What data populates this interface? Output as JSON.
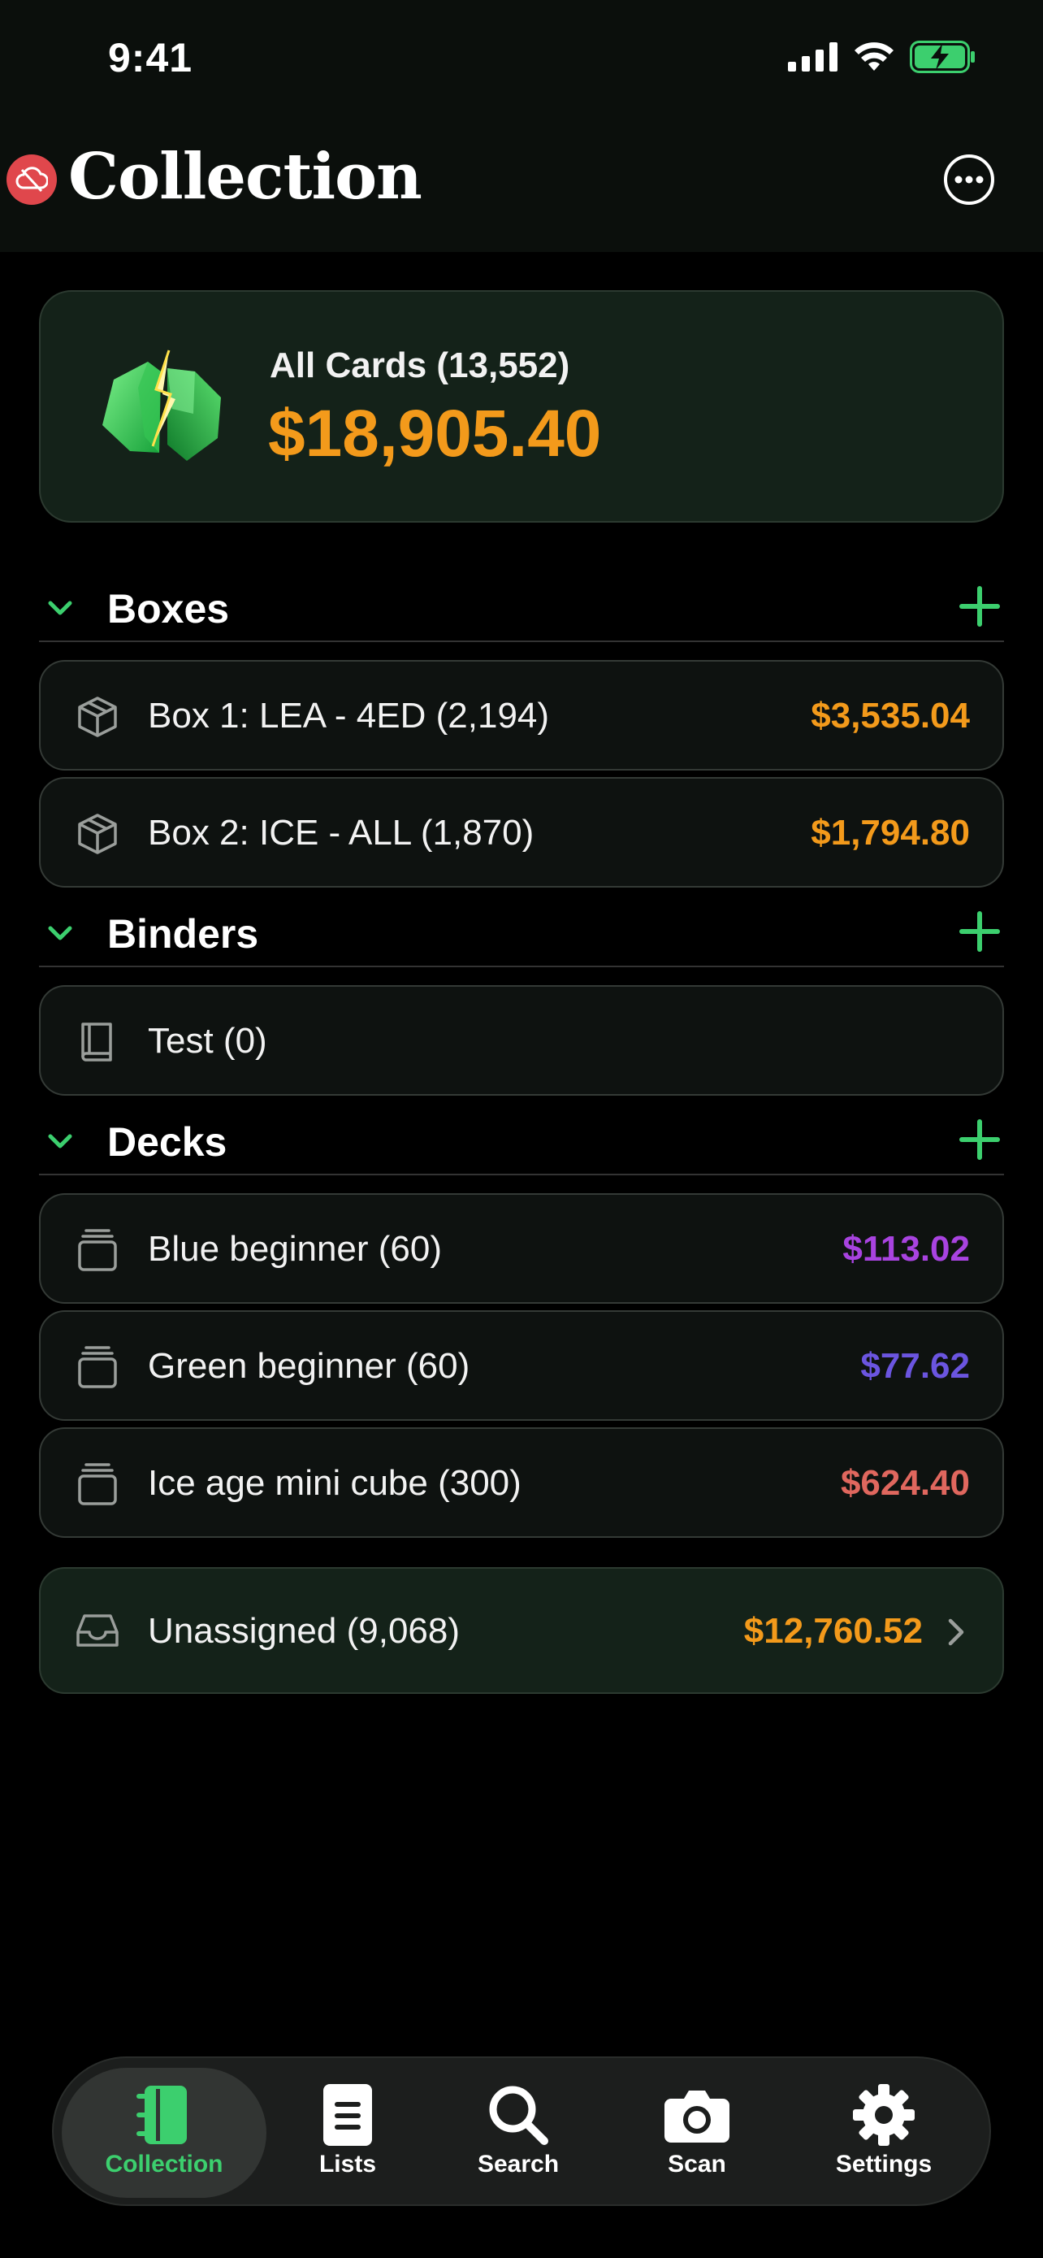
{
  "status_bar": {
    "time": "9:41"
  },
  "header": {
    "title": "Collection"
  },
  "summary": {
    "label": "All Cards (13,552)",
    "value": "$18,905.40"
  },
  "sections": {
    "boxes": {
      "title": "Boxes",
      "items": [
        {
          "label": "Box 1: LEA - 4ED (2,194)",
          "value": "$3,535.04",
          "value_color": "#f39a1b",
          "icon": "box-icon"
        },
        {
          "label": "Box 2: ICE - ALL (1,870)",
          "value": "$1,794.80",
          "value_color": "#f39a1b",
          "icon": "box-icon"
        }
      ]
    },
    "binders": {
      "title": "Binders",
      "items": [
        {
          "label": "Test (0)",
          "value": "",
          "icon": "binder-icon"
        }
      ]
    },
    "decks": {
      "title": "Decks",
      "items": [
        {
          "label": "Blue beginner (60)",
          "value": "$113.02",
          "value_color": "#a843e0",
          "icon": "deck-icon"
        },
        {
          "label": "Green beginner (60)",
          "value": "$77.62",
          "value_color": "#6b55e0",
          "icon": "deck-icon"
        },
        {
          "label": "Ice age mini cube (300)",
          "value": "$624.40",
          "value_color": "#e0675e",
          "icon": "deck-icon"
        }
      ]
    }
  },
  "unassigned": {
    "label": "Unassigned (9,068)",
    "value": "$12,760.52",
    "icon": "inbox-icon"
  },
  "tab_bar": {
    "tabs": [
      {
        "label": "Collection",
        "icon": "collection-icon",
        "active": true
      },
      {
        "label": "Lists",
        "icon": "lists-icon",
        "active": false
      },
      {
        "label": "Search",
        "icon": "search-icon",
        "active": false
      },
      {
        "label": "Scan",
        "icon": "camera-icon",
        "active": false
      },
      {
        "label": "Settings",
        "icon": "gear-icon",
        "active": false
      }
    ]
  },
  "colors": {
    "accent_green": "#3ccf6e",
    "price_orange": "#f39a1b",
    "sync_badge_red": "#e0474c"
  }
}
